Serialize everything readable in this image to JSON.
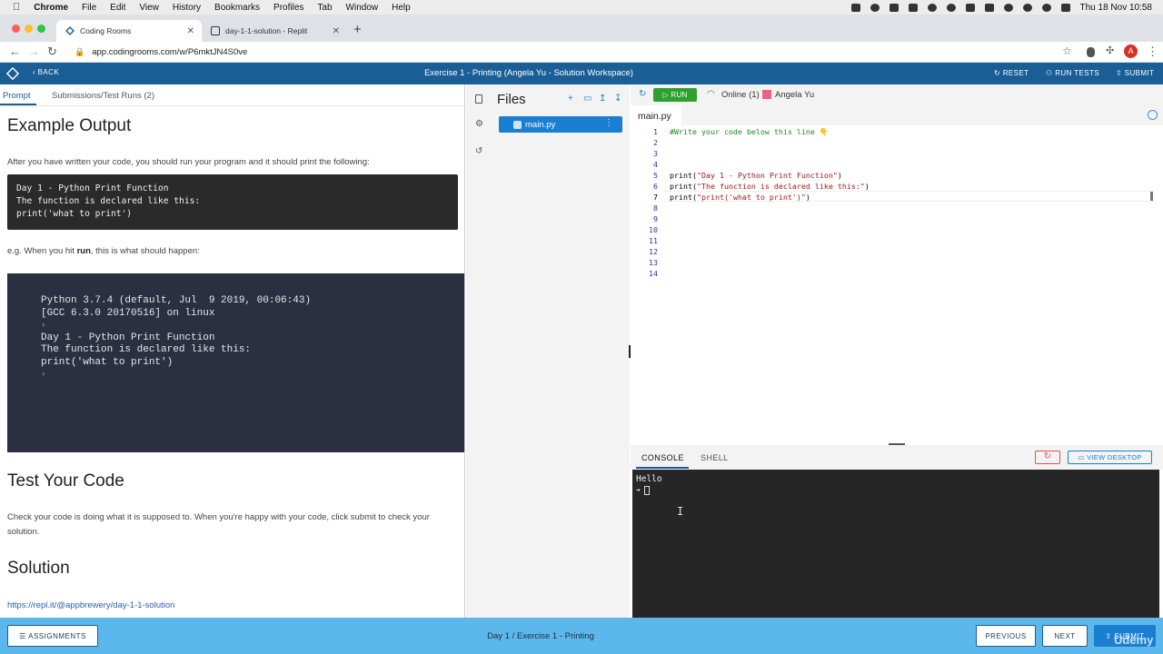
{
  "menubar": {
    "apple": "",
    "app_name": "Chrome",
    "items": [
      "File",
      "Edit",
      "View",
      "History",
      "Bookmarks",
      "Profiles",
      "Tab",
      "Window",
      "Help"
    ],
    "datetime": "Thu 18 Nov  10:58"
  },
  "tabs": [
    {
      "title": "Coding Rooms",
      "close": "✕"
    },
    {
      "title": "day-1-1-solution - Replit",
      "close": "✕"
    }
  ],
  "new_tab": "+",
  "address": {
    "url": "app.codingrooms.com/w/P6mktJN4S0ve",
    "back": "←",
    "forward": "→",
    "reload": "↻",
    "star": "☆",
    "avatar": "A",
    "more": "⋮"
  },
  "header": {
    "back": "‹  BACK",
    "title": "Exercise 1 - Printing (Angela Yu - Solution Workspace)",
    "reset": "↻ RESET",
    "run_tests": "⚇ RUN TESTS",
    "submit": "⇧ SUBMIT"
  },
  "left": {
    "tab_prompt": "Prompt",
    "tab_submissions": "Submissions/Test Runs (2)",
    "h_example": "Example Output",
    "p_after": "After you have written your code, you should run your program and it should print the following:",
    "code_block": "Day 1 - Python Print Function\nThe function is declared like this:\nprint('what to print')",
    "p_eg_prefix": "e.g. When you hit ",
    "p_eg_run": "run",
    "p_eg_suffix": ", this is what should happen:",
    "terminal_lines": "Python 3.7.4 (default, Jul  9 2019, 00:06:43)\n[GCC 6.3.0 20170516] on linux",
    "terminal_prompt1": "›",
    "terminal_output": "Day 1 - Python Print Function\nThe function is declared like this:\nprint('what to print')",
    "terminal_prompt2": "›",
    "h_test": "Test Your Code",
    "p_test": "Check your code is doing what it is supposed to. When you're happy with your code, click submit to check your solution.",
    "h_solution": "Solution",
    "solution_link": "https://repl.it/@appbrewery/day-1-1-solution"
  },
  "files": {
    "title": "Files",
    "file_name": "main.py",
    "actions": [
      "+",
      "▭",
      "↥",
      "↧"
    ]
  },
  "editor": {
    "run": "▷ RUN",
    "online": "Online (1)",
    "user": "Angela Yu",
    "tab": "main.py",
    "line_numbers": [
      "1",
      "2",
      "3",
      "4",
      "5",
      "6",
      "7",
      "8",
      "9",
      "10",
      "11",
      "12",
      "13",
      "14"
    ],
    "lines": [
      "#Write your code below this line 👇",
      "",
      "",
      "",
      "print(\"Day 1 - Python Print Function\")",
      "print(\"The function is declared like this:\")",
      "print(\"print('what to print')\")",
      "",
      "",
      "",
      "",
      "",
      "",
      ""
    ]
  },
  "console": {
    "tab_console": "CONSOLE",
    "tab_shell": "SHELL",
    "restart": "↻",
    "view_desktop": "▭ VIEW DESKTOP",
    "output": "Hello",
    "prompt": "➔"
  },
  "footer": {
    "assignments": "☰ ASSIGNMENTS",
    "title": "Day 1 / Exercise 1 - Printing",
    "previous": "PREVIOUS",
    "next": "NEXT",
    "submit": "⇧ SUBMIT",
    "watermark": "Udemy"
  },
  "colors": {
    "header": "#1a5e96",
    "footer": "#5cb8ec",
    "run": "#2ea02e",
    "accent": "#1a7fd0"
  }
}
